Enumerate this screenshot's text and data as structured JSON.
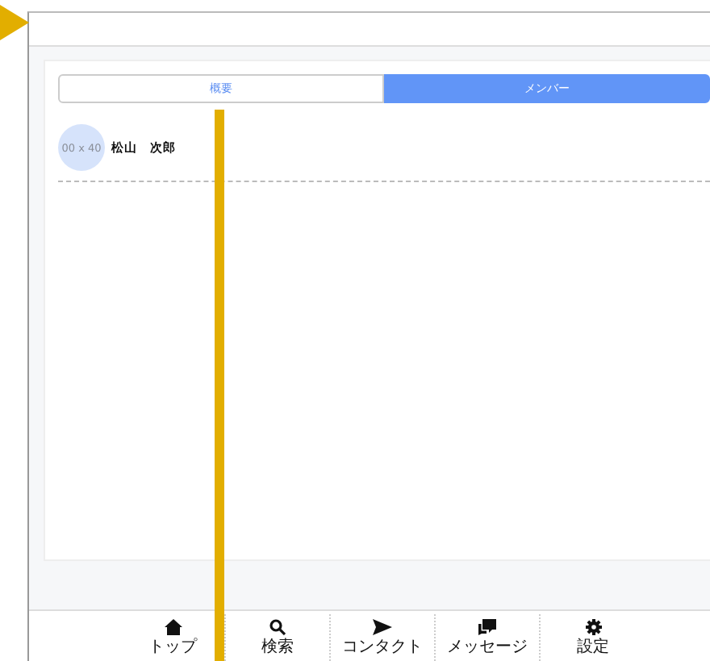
{
  "tabs": [
    {
      "label": "概要",
      "selected": false
    },
    {
      "label": "メンバー",
      "selected": true
    }
  ],
  "members": [
    {
      "avatar_text": "00 x 40",
      "name": "松山　次郎"
    }
  ],
  "bottom_nav": [
    {
      "kind": "home",
      "label": "トップ"
    },
    {
      "kind": "search",
      "label": "検索"
    },
    {
      "kind": "send",
      "label": "コンタクト"
    },
    {
      "kind": "message",
      "label": "メッセージ"
    },
    {
      "kind": "settings",
      "label": "設定"
    }
  ]
}
